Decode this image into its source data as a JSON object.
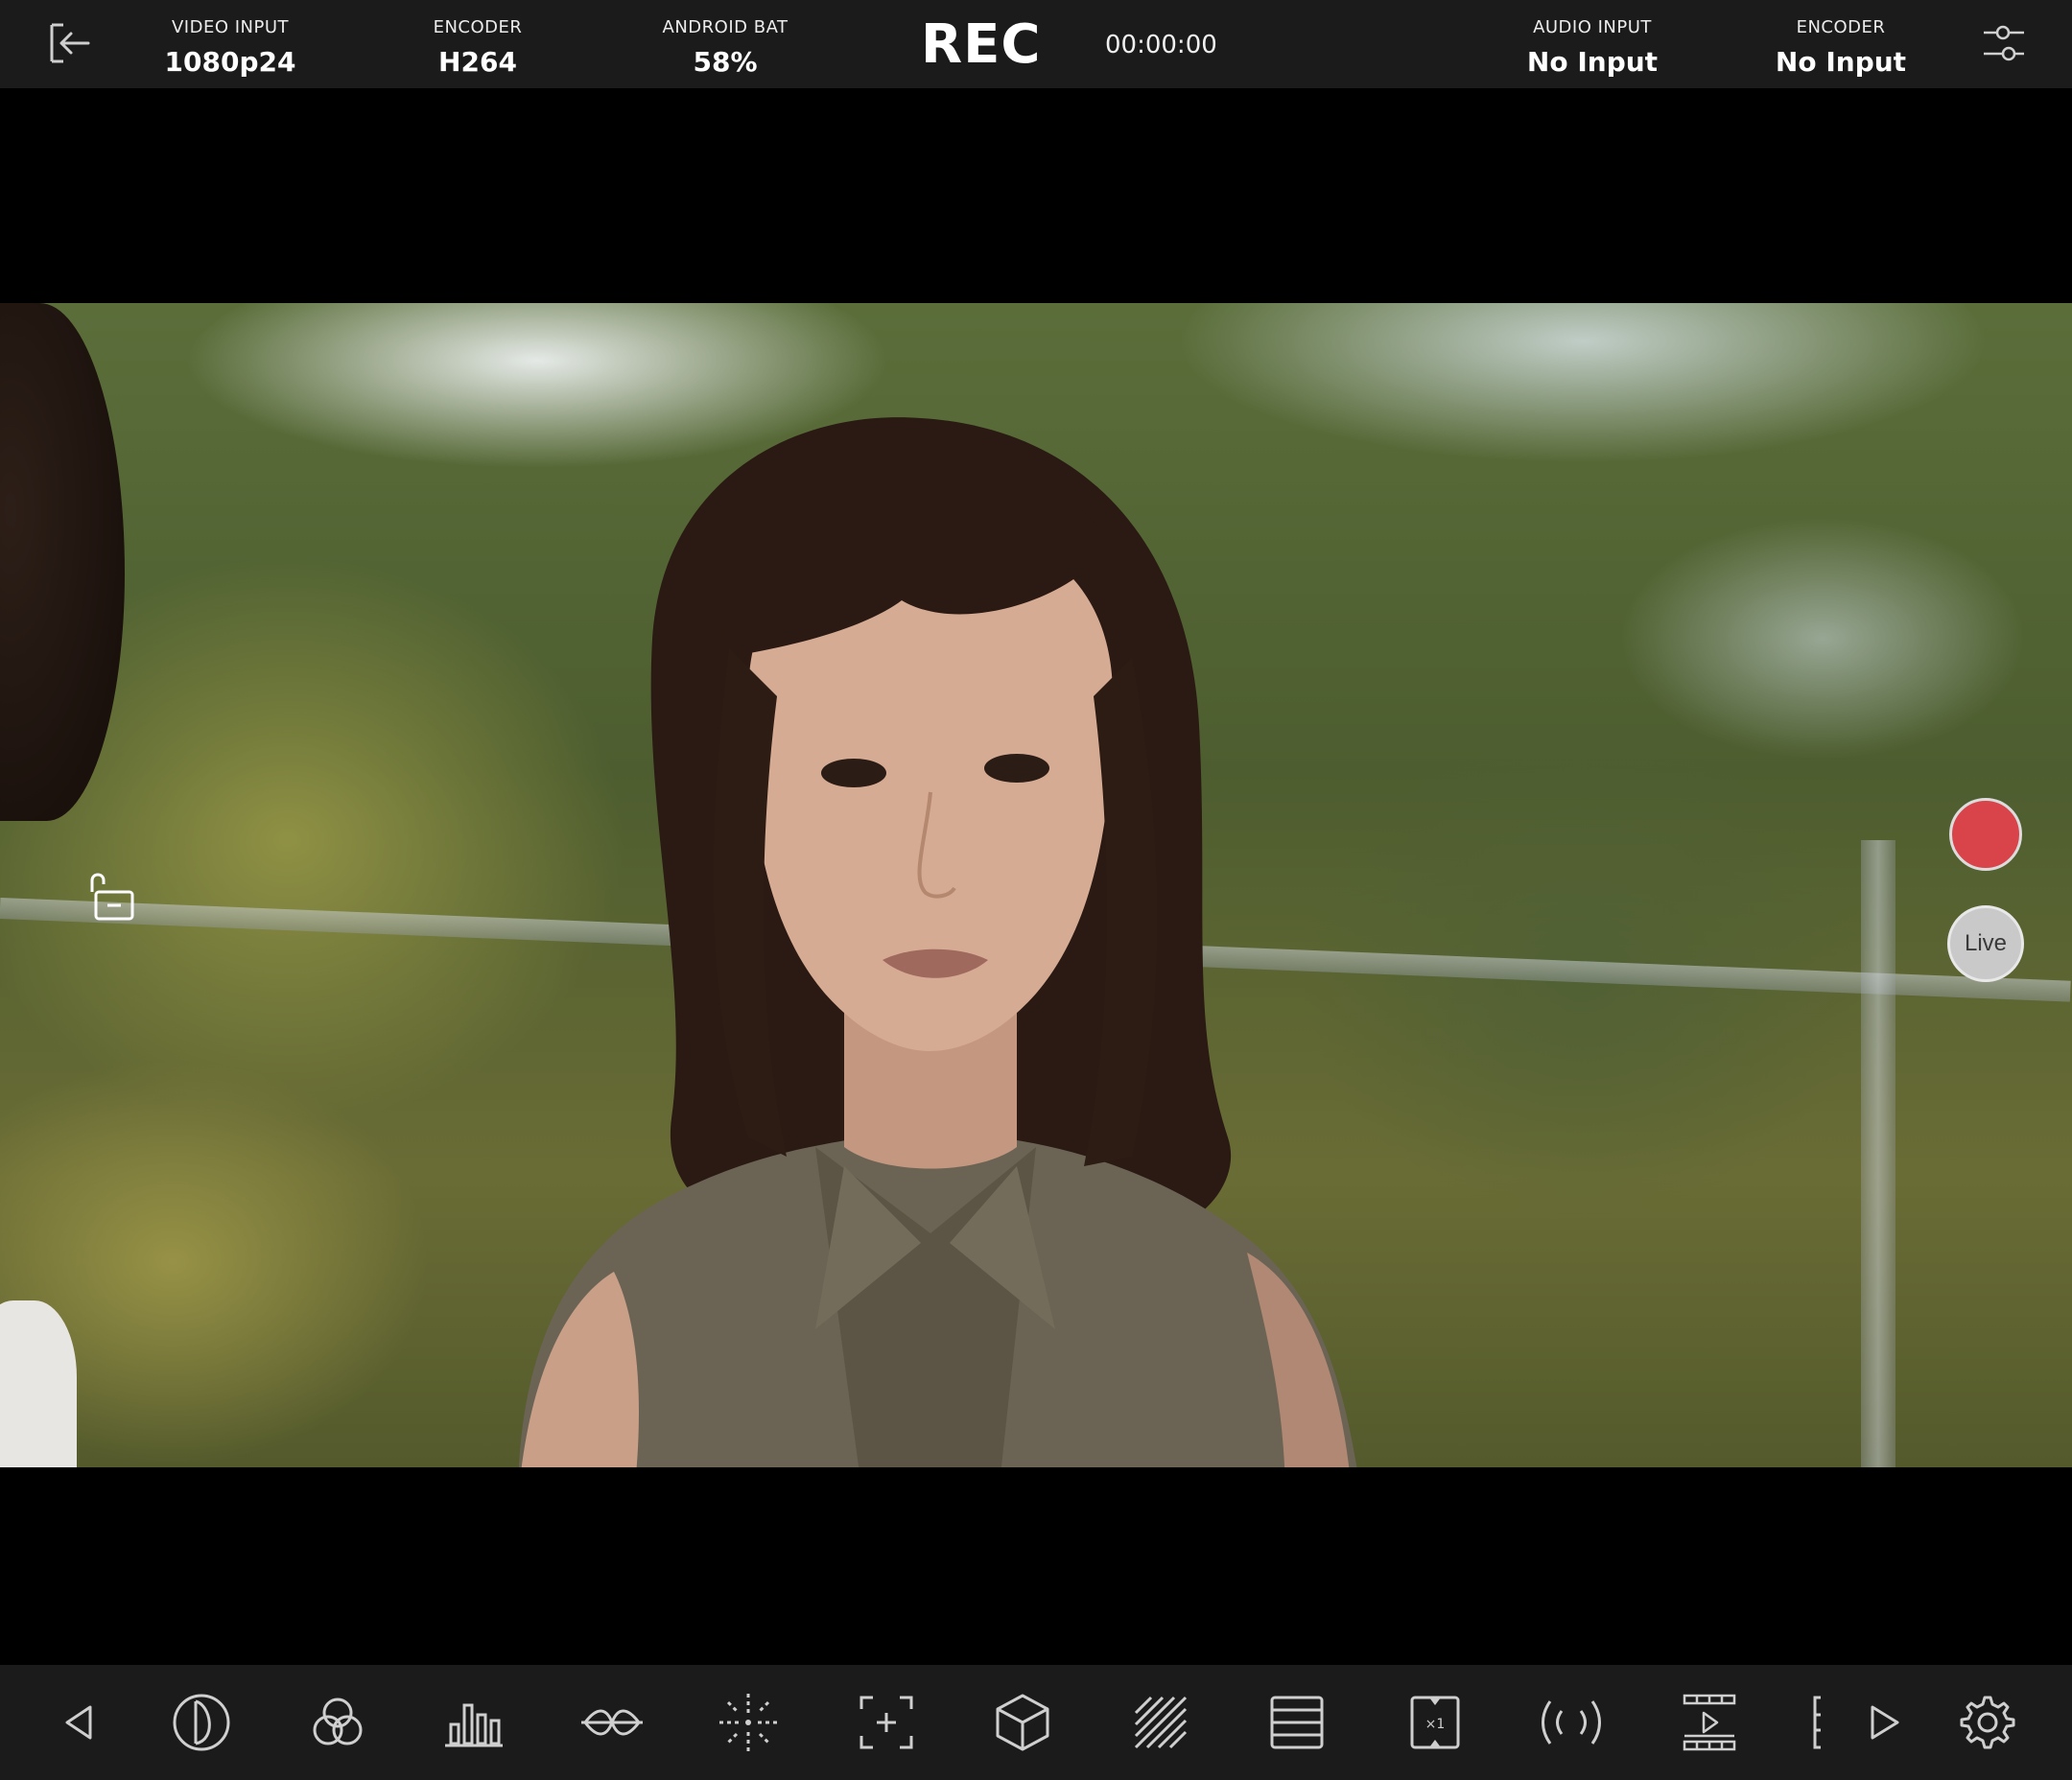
{
  "top_bar": {
    "video_input": {
      "label": "VIDEO INPUT",
      "value": "1080p24"
    },
    "encoder_video": {
      "label": "ENCODER",
      "value": "H264"
    },
    "android_battery": {
      "label": "ANDROID BAT",
      "value": "58%"
    },
    "rec_label": "REC",
    "timecode": "00:00:00",
    "audio_input": {
      "label": "AUDIO INPUT",
      "value": "No Input"
    },
    "encoder_audio": {
      "label": "ENCODER",
      "value": "No Input"
    }
  },
  "side_controls": {
    "live_label": "Live",
    "record_color": "#d8444a"
  },
  "toolbar": {
    "items": [
      {
        "icon": "back-triangle-icon"
      },
      {
        "icon": "exposure-icon"
      },
      {
        "icon": "color-channels-icon"
      },
      {
        "icon": "histogram-icon"
      },
      {
        "icon": "waveform-icon"
      },
      {
        "icon": "focus-peaking-icon"
      },
      {
        "icon": "frame-guide-icon"
      },
      {
        "icon": "3d-lut-icon"
      },
      {
        "icon": "zebra-icon"
      },
      {
        "icon": "false-color-icon"
      },
      {
        "icon": "anamorphic-desqueeze-icon"
      },
      {
        "icon": "audio-meter-icon"
      },
      {
        "icon": "playback-icon"
      },
      {
        "icon": "more-expand-icon"
      },
      {
        "icon": "settings-gear-icon"
      }
    ]
  }
}
